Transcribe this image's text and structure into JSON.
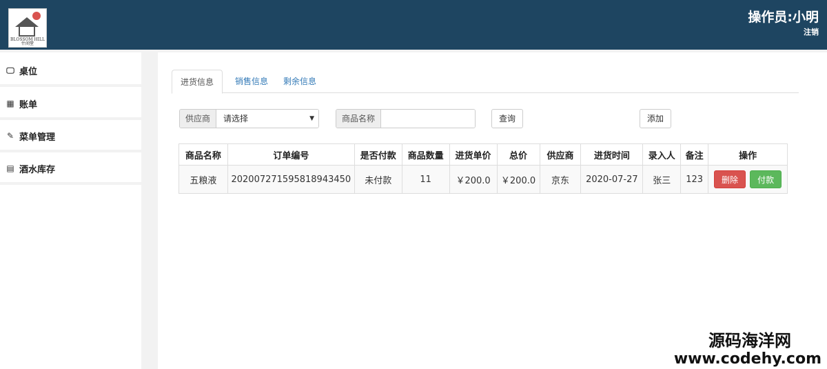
{
  "header": {
    "logo_text": "BLOSSOM HILL",
    "logo_subtext": "什间堂",
    "operator": "操作员:小明",
    "logout": "注销"
  },
  "sidebar": {
    "items": [
      {
        "label": "桌位",
        "icon": "monitor-icon"
      },
      {
        "label": "账单",
        "icon": "table-icon"
      },
      {
        "label": "菜单管理",
        "icon": "edit-icon"
      },
      {
        "label": "酒水库存",
        "icon": "grid-icon"
      }
    ]
  },
  "tabs": [
    {
      "label": "进货信息",
      "active": true
    },
    {
      "label": "销售信息",
      "active": false
    },
    {
      "label": "剩余信息",
      "active": false
    }
  ],
  "filters": {
    "supplier_label": "供应商",
    "supplier_selected": "请选择",
    "product_label": "商品名称",
    "product_value": "",
    "query_button": "查询",
    "add_button": "添加"
  },
  "table": {
    "columns": [
      "商品名称",
      "订单编号",
      "是否付款",
      "商品数量",
      "进货单价",
      "总价",
      "供应商",
      "进货时间",
      "录入人",
      "备注",
      "操作"
    ],
    "rows": [
      {
        "name": "五粮液",
        "order_no": "20200727159581894345​0",
        "paid": "未付款",
        "qty": "11",
        "unit_price": "￥200.0",
        "total": "￥200.0",
        "supplier": "京东",
        "date": "2020-07-27",
        "entered_by": "张三",
        "note": "123",
        "delete_label": "删除",
        "pay_label": "付款"
      }
    ]
  },
  "watermark": {
    "cn": "源码海洋网",
    "url": "www.codehy.com"
  },
  "colors": {
    "header_bg": "#1e4561",
    "danger": "#d9534f",
    "success": "#5cb85c",
    "link": "#337ab7"
  }
}
